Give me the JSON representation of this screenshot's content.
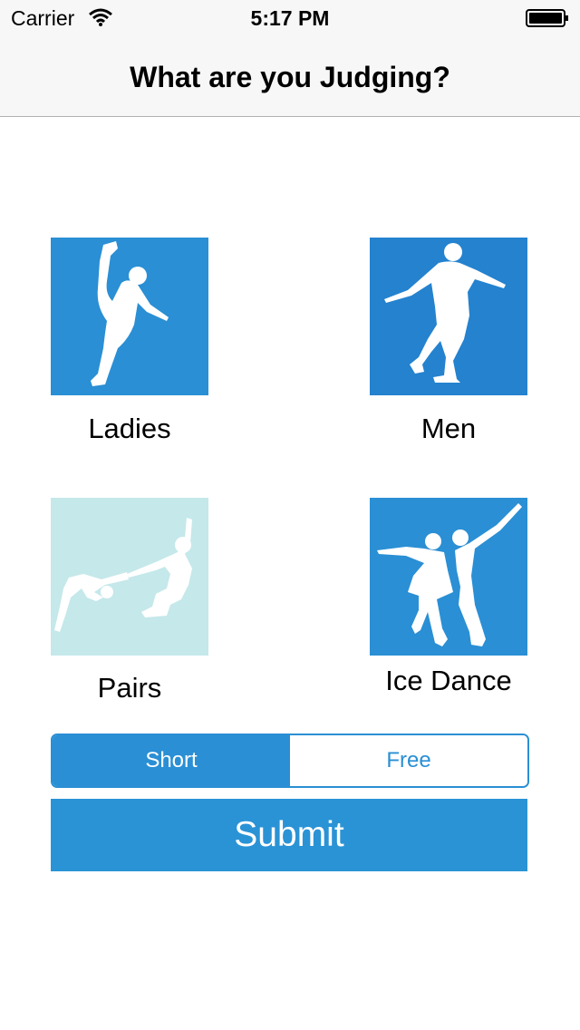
{
  "status_bar": {
    "carrier": "Carrier",
    "time": "5:17 PM",
    "wifi_icon": "wifi-icon",
    "battery_icon": "battery-icon"
  },
  "nav": {
    "title": "What are you Judging?"
  },
  "categories": [
    {
      "label": "Ladies",
      "icon": "ladies-skater-icon",
      "color": "#2a8fd4"
    },
    {
      "label": "Men",
      "icon": "men-skater-icon",
      "color": "#2482cf"
    },
    {
      "label": "Pairs",
      "icon": "pairs-skaters-icon",
      "color": "#c5e8ea"
    },
    {
      "label": "Ice Dance",
      "icon": "ice-dance-skaters-icon",
      "color": "#2a8fd4"
    }
  ],
  "program": {
    "options": [
      "Short",
      "Free"
    ],
    "selected": "Short"
  },
  "submit_label": "Submit",
  "colors": {
    "accent": "#2a8fd4",
    "bar_background": "#f7f7f7",
    "pairs_tile": "#c5e8ea"
  }
}
